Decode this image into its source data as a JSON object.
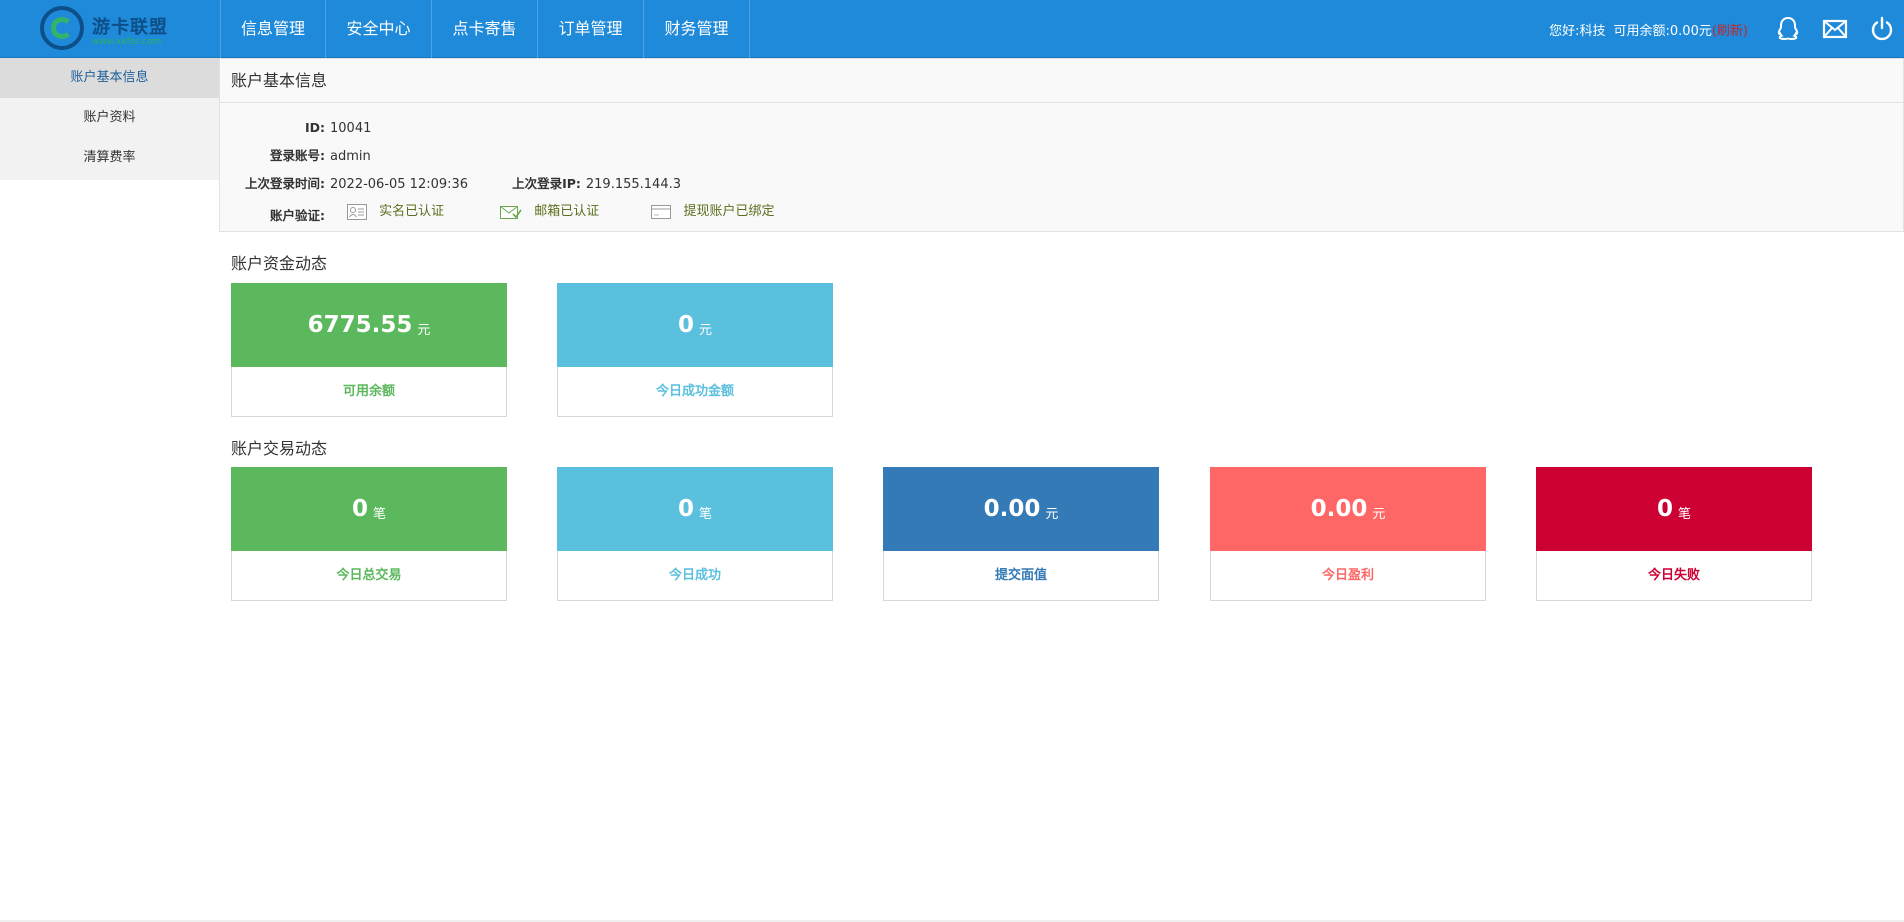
{
  "brand": {
    "title": "游卡联盟",
    "subtitle": "www.xkfss.com"
  },
  "nav": [
    {
      "label": "信息管理"
    },
    {
      "label": "安全中心"
    },
    {
      "label": "点卡寄售"
    },
    {
      "label": "订单管理"
    },
    {
      "label": "财务管理"
    }
  ],
  "topbar": {
    "greeting": "您好:科技",
    "balance_label": "可用余额:",
    "balance_value": "0.00元",
    "refresh_label": "(刷新)"
  },
  "sidebar": [
    {
      "label": "账户基本信息",
      "active": true
    },
    {
      "label": "账户资料",
      "active": false
    },
    {
      "label": "清算费率",
      "active": false
    }
  ],
  "info": {
    "title": "账户基本信息",
    "id_label": "ID:",
    "id_value": "10041",
    "account_label": "登录账号:",
    "account_value": "admin",
    "last_time_label": "上次登录时间:",
    "last_time_value": "2022-06-05 12:09:36",
    "last_ip_label": "上次登录IP:",
    "last_ip_value": "219.155.144.3",
    "verify_label": "账户验证:",
    "verify_items": [
      {
        "label": "实名已认证",
        "icon": "id-card-icon"
      },
      {
        "label": "邮箱已认证",
        "icon": "envelope-check-icon"
      },
      {
        "label": "提现账户已绑定",
        "icon": "bank-card-icon"
      }
    ]
  },
  "funds": {
    "title": "账户资金动态",
    "cards": [
      {
        "value": "6775.55",
        "unit": "元",
        "label": "可用余额",
        "color": "#5cb85c"
      },
      {
        "value": "0",
        "unit": "元",
        "label": "今日成功金额",
        "color": "#5bc0de"
      }
    ]
  },
  "trades": {
    "title": "账户交易动态",
    "cards": [
      {
        "value": "0",
        "unit": "笔",
        "label": "今日总交易",
        "color": "#5cb85c"
      },
      {
        "value": "0",
        "unit": "笔",
        "label": "今日成功",
        "color": "#5bc0de"
      },
      {
        "value": "0.00",
        "unit": "元",
        "label": "提交面值",
        "color": "#337ab7"
      },
      {
        "value": "0.00",
        "unit": "元",
        "label": "今日盈利",
        "color": "#ff6666"
      },
      {
        "value": "0",
        "unit": "笔",
        "label": "今日失败",
        "color": "#cc0033"
      }
    ]
  },
  "icons": [
    "qq-icon",
    "mail-icon",
    "power-icon"
  ]
}
